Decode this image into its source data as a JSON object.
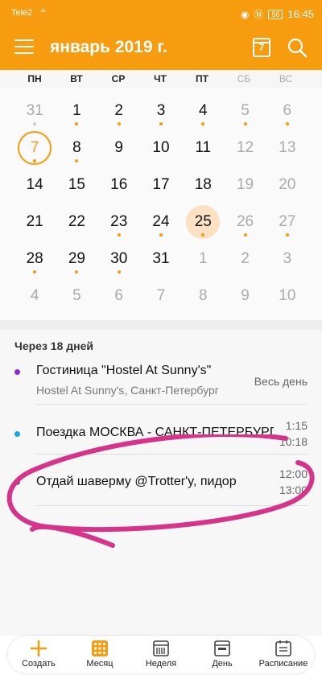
{
  "status_bar": {
    "carrier": "Tele2",
    "signal": "⁴ᴳ",
    "battery": "56",
    "time": "16:45"
  },
  "header": {
    "title": "январь 2019 г.",
    "today_num": "7"
  },
  "colors": {
    "accent": "#f79b0f",
    "purple": "#8a2bd6",
    "blue": "#1aa3e0",
    "scribble": "#d6338a"
  },
  "weekdays": [
    "ПН",
    "ВТ",
    "СР",
    "ЧТ",
    "ПТ",
    "СБ",
    "ВС"
  ],
  "weeks": [
    [
      "31",
      "1",
      "2",
      "3",
      "4",
      "5",
      "6"
    ],
    [
      "7",
      "8",
      "9",
      "10",
      "11",
      "12",
      "13"
    ],
    [
      "14",
      "15",
      "16",
      "17",
      "18",
      "19",
      "20"
    ],
    [
      "21",
      "22",
      "23",
      "24",
      "25",
      "26",
      "27"
    ],
    [
      "28",
      "29",
      "30",
      "31",
      "1",
      "2",
      "3"
    ],
    [
      "4",
      "5",
      "6",
      "7",
      "8",
      "9",
      "10"
    ]
  ],
  "events_section": {
    "heading": "Через 18 дней",
    "events": [
      {
        "title": "Гостиница \"Hostel At Sunny's\"",
        "subtitle": "Hostel At Sunny's, Санкт-Петербург",
        "time": "Весь день"
      },
      {
        "title": "Поездка МОСКВА - САНКТ-ПЕТЕРБУРГ",
        "time_start": "1:15",
        "time_end": "10:18"
      },
      {
        "title": "Отдай шаверму @Trotter'y, пидор",
        "time_start": "12:00",
        "time_end": "13:00"
      }
    ]
  },
  "nav": [
    {
      "label": "Создать",
      "icon": "plus-icon"
    },
    {
      "label": "Месяц",
      "icon": "month-grid-icon"
    },
    {
      "label": "Неделя",
      "icon": "week-icon"
    },
    {
      "label": "День",
      "icon": "day-icon"
    },
    {
      "label": "Расписание",
      "icon": "schedule-icon"
    }
  ]
}
